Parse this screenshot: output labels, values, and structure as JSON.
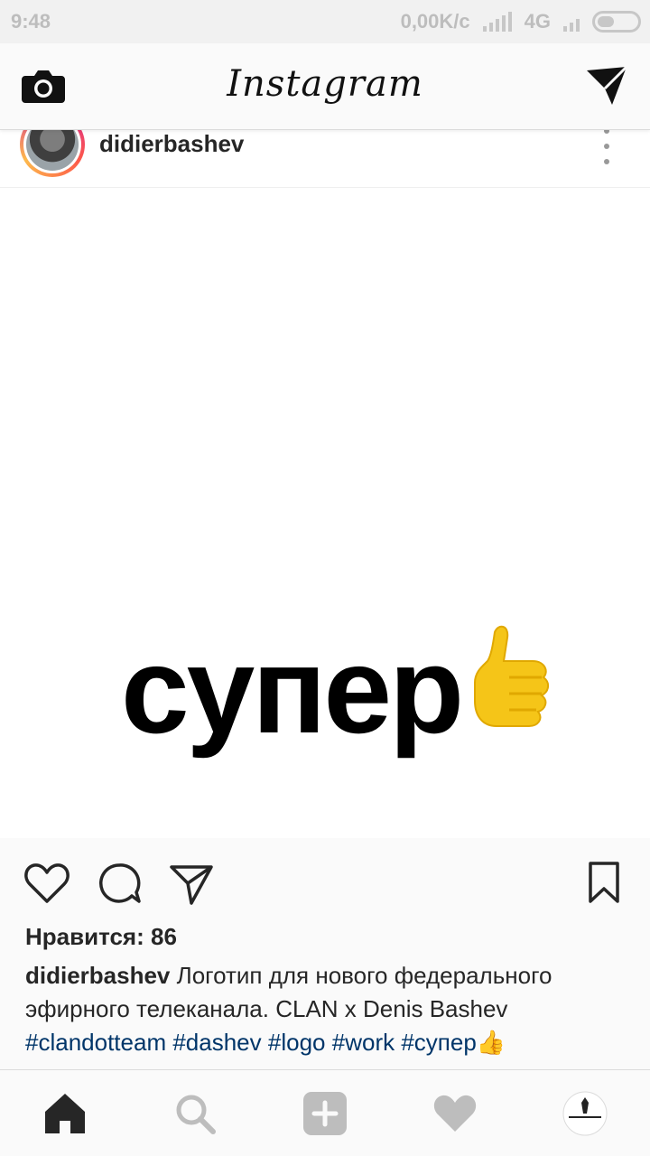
{
  "status_bar": {
    "time": "9:48",
    "net_speed": "0,00K/c",
    "network": "4G"
  },
  "header": {
    "logo": "Instagram",
    "icons": [
      "camera-icon",
      "direct-message-icon"
    ]
  },
  "post": {
    "username": "didierbashev",
    "image_word": "супер",
    "image_emoji": "thumbs-up",
    "likes_label": "Нравится: 86",
    "caption": {
      "username": "didierbashev",
      "text_line1": " Логотип для нового федерального",
      "text_line2": "эфирного телеканала. CLAN x Denis Bashev",
      "hashtags": [
        "#clandotteam",
        "#dashev",
        "#logo",
        "#work",
        "#супер"
      ],
      "trailing_emoji": "👍"
    }
  },
  "bottom_nav": {
    "items": [
      "home-icon",
      "search-icon",
      "add-icon",
      "activity-icon",
      "profile-icon"
    ]
  },
  "colors": {
    "hashtag": "#003569",
    "text": "#262626",
    "thumb_yellow": "#f5c518"
  }
}
